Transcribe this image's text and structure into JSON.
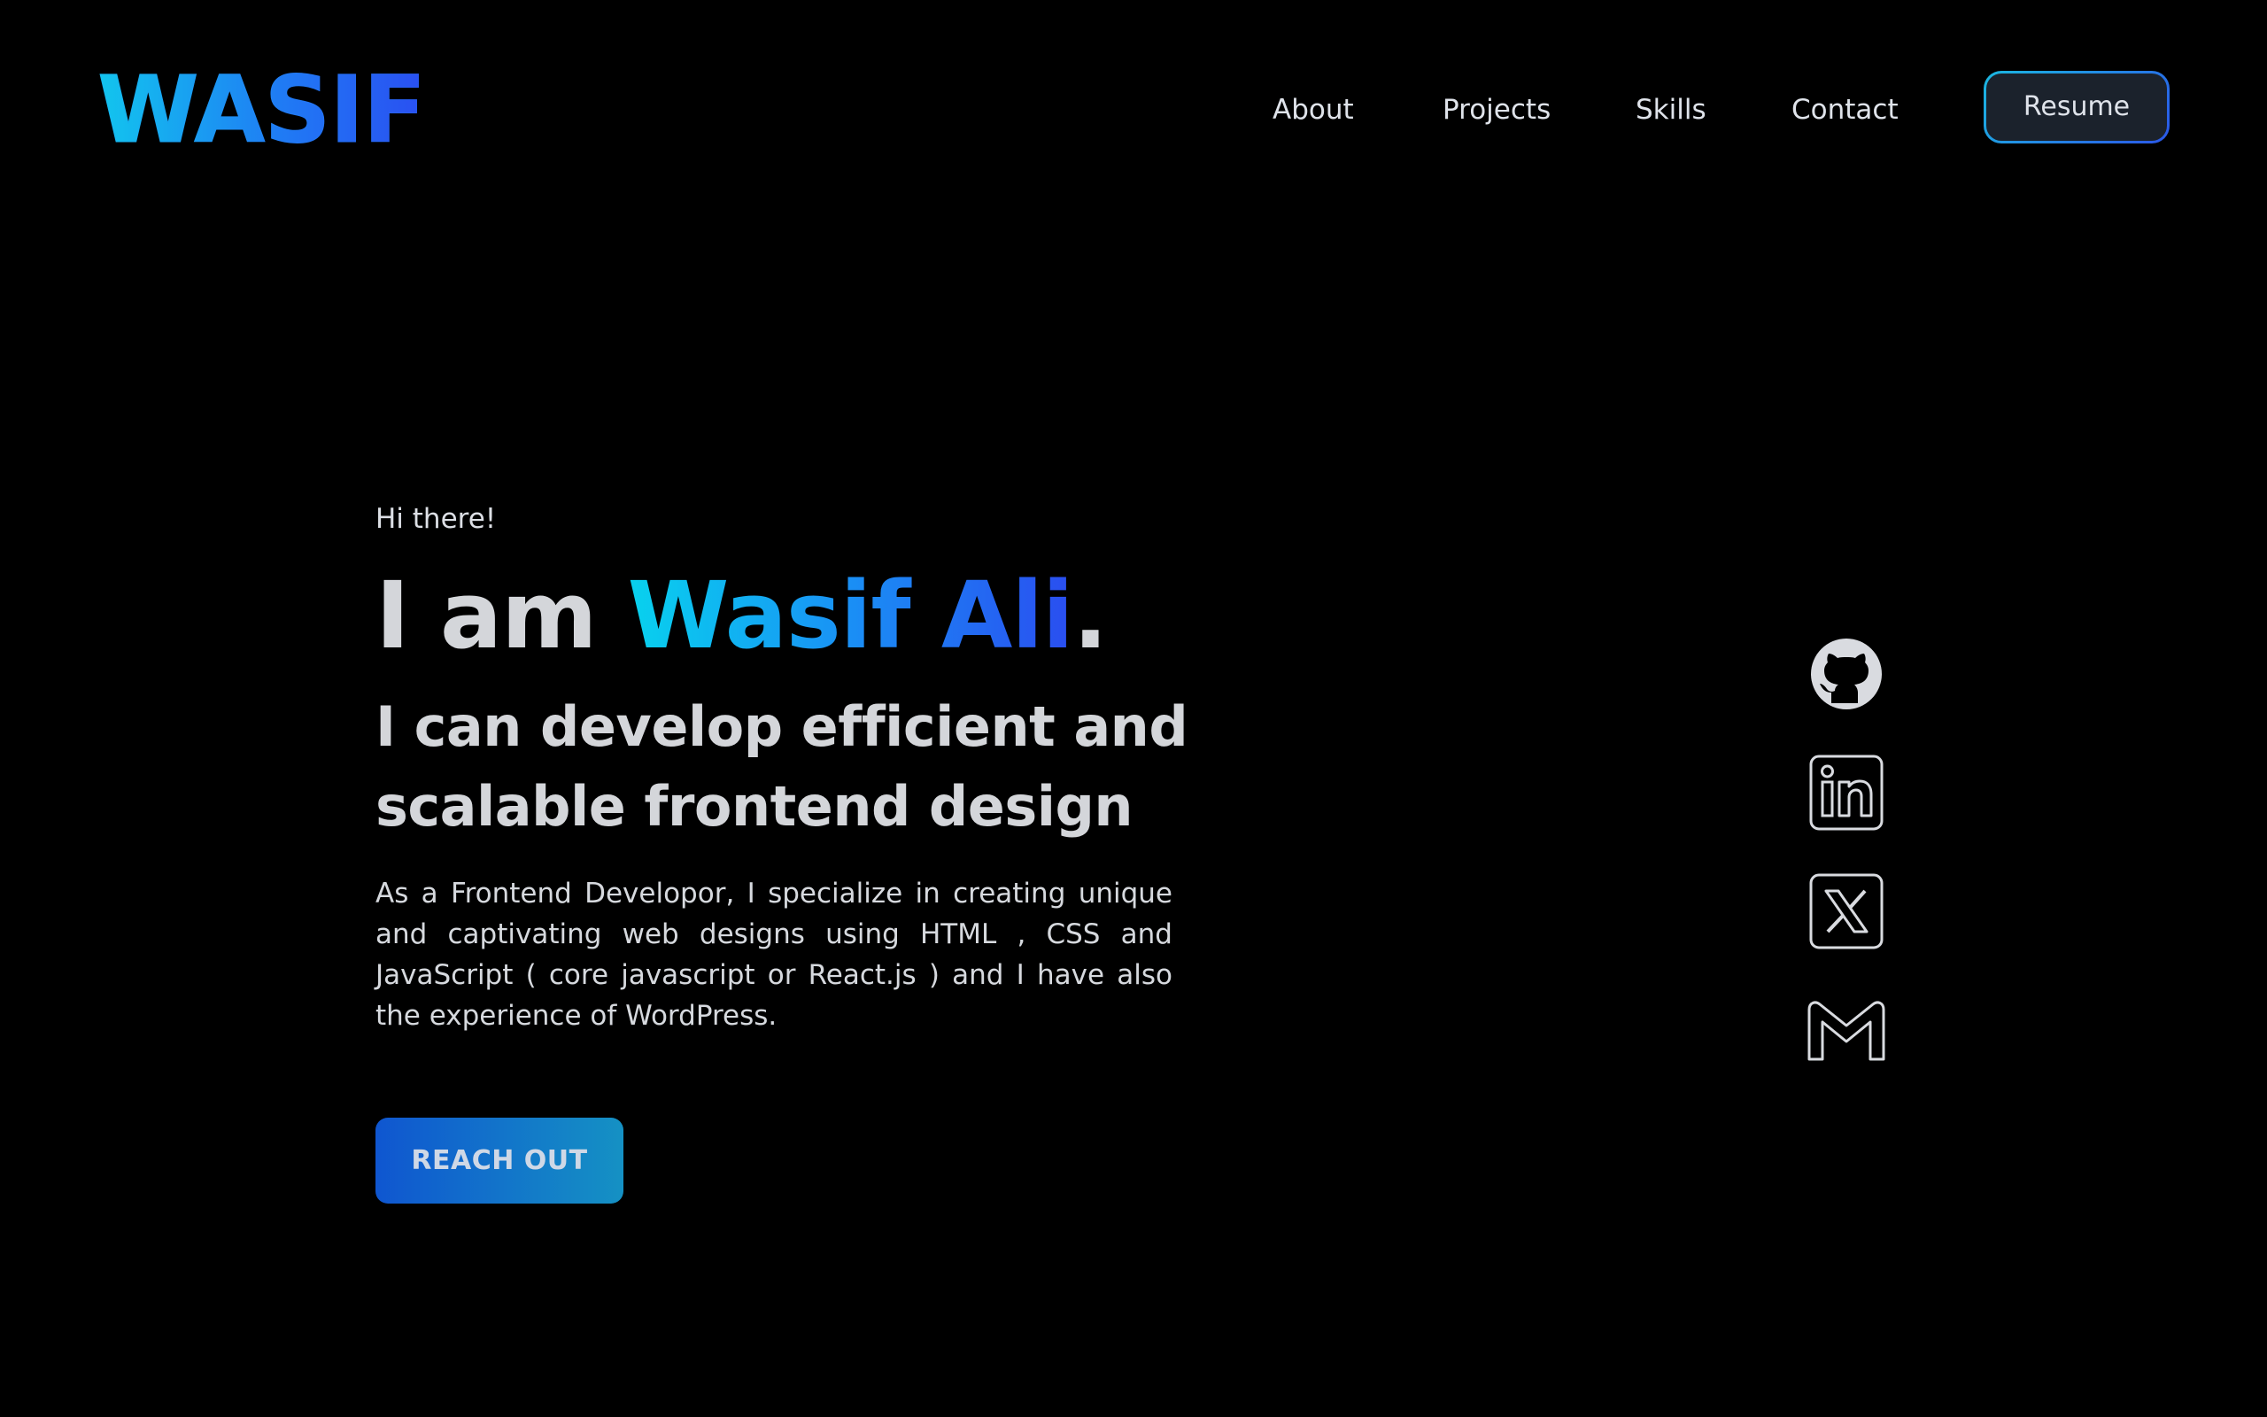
{
  "header": {
    "logo": "WASIF",
    "nav": [
      {
        "label": "About"
      },
      {
        "label": "Projects"
      },
      {
        "label": "Skills"
      },
      {
        "label": "Contact"
      }
    ],
    "resume_label": "Resume"
  },
  "hero": {
    "greeting": "Hi there!",
    "headline_prefix": "I am ",
    "headline_name": "Wasif Ali",
    "headline_suffix": ".",
    "tagline": "I can develop efficient and scalable frontend design",
    "description": "As a Frontend Developor, I specialize in creating unique and captivating web designs using HTML , CSS and JavaScript ( core javascript or React.js ) and I have also the experience of WordPress.",
    "cta_label": "REACH OUT"
  },
  "socials": [
    {
      "icon": "github-icon"
    },
    {
      "icon": "linkedin-icon"
    },
    {
      "icon": "x-twitter-icon"
    },
    {
      "icon": "gmail-icon"
    }
  ],
  "colors": {
    "background": "#000000",
    "accent_cyan": "#08d2ee",
    "accent_blue": "#2a4df0",
    "text": "#d4d6da"
  }
}
